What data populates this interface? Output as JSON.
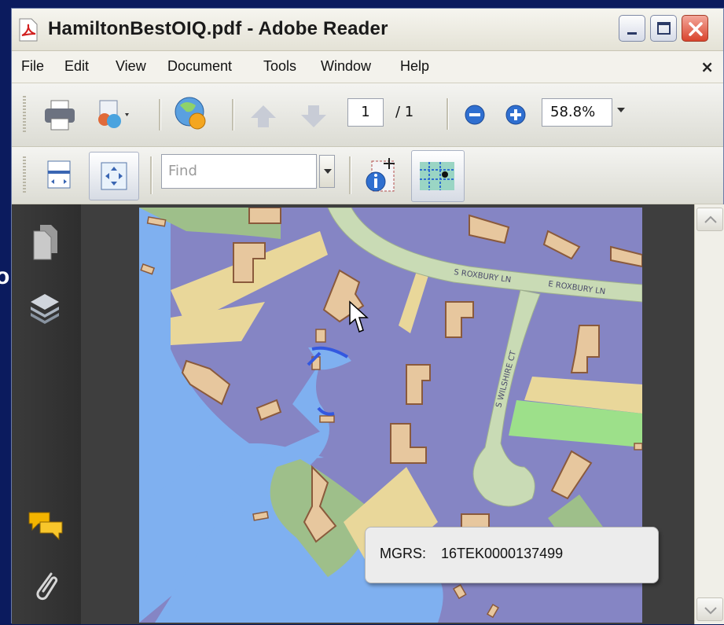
{
  "window": {
    "title": "HamiltonBestOIQ.pdf - Adobe Reader",
    "buttons": {
      "minimize": "minimize-icon",
      "maximize": "maximize-icon",
      "close": "close-icon"
    }
  },
  "menu": {
    "items": [
      "File",
      "Edit",
      "View",
      "Document",
      "Tools",
      "Window",
      "Help"
    ],
    "close": "×"
  },
  "toolbar": {
    "page_current": "1",
    "page_total": "/ 1",
    "zoom": "58.8%",
    "find_placeholder": "Find"
  },
  "map": {
    "streets": [
      "S ROXBURY LN",
      "E ROXBURY LN",
      "S WILSHIRE CT"
    ]
  },
  "popup": {
    "label": "MGRS:",
    "value": "16TEK0000137499"
  },
  "slide": {
    "clipped_text": "o"
  },
  "colors": {
    "water": "#7fb0f0",
    "parcel": "#8585c4",
    "road": "#c9dbb5",
    "building": "#e7c79e",
    "park": "#9fd788"
  }
}
